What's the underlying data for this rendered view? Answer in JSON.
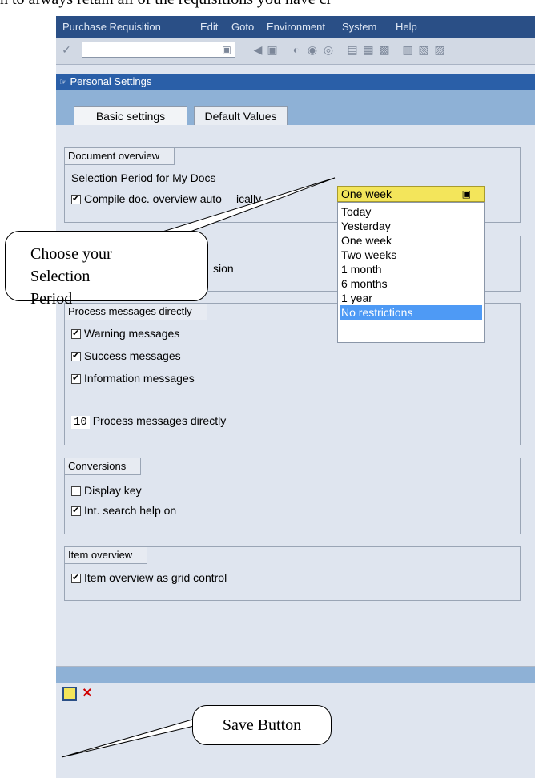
{
  "document_heading": "n to always retain all of the requisitions you have cr",
  "menubar": {
    "items": [
      "Purchase Requisition",
      "Edit",
      "Goto",
      "Environment",
      "System",
      "Help"
    ]
  },
  "title": "Personal Settings",
  "tabs": [
    "Basic settings",
    "Default Values"
  ],
  "groups": {
    "document_overview": {
      "title": "Document overview",
      "selection_label": "Selection Period for My Docs",
      "compile_label": "Compile doc. overview automatically",
      "compile_display": "Compile doc. overview auto",
      "compile_tail": "ically",
      "compile_checked": true
    },
    "hidden_group": {
      "label_tail": "sion"
    },
    "process_messages": {
      "title": "Process messages directly",
      "warning": "Warning messages",
      "success": "Success messages",
      "information": "Information messages",
      "counter_value": "10",
      "counter_label": "Process messages directly"
    },
    "conversions": {
      "title": "Conversions",
      "display_key": "Display key",
      "display_key_checked": false,
      "int_search": "Int. search help on",
      "int_search_checked": true
    },
    "item_overview": {
      "title": "Item overview",
      "grid_control": "Item overview as grid control",
      "grid_control_checked": true
    }
  },
  "dropdown": {
    "selected": "One week",
    "options": [
      "Today",
      "Yesterday",
      "One week",
      "Two weeks",
      "1 month",
      "6 months",
      "1 year",
      "No restrictions"
    ],
    "highlighted_option": "No restrictions"
  },
  "callouts": {
    "selection": "Choose your Selection Period",
    "save": "Save Button"
  },
  "bottom_toolbar": {
    "save_icon": "save-icon",
    "cancel_icon": "cancel-icon"
  },
  "colors": {
    "menubar": "#2a4f86",
    "titlebar": "#2a5fa8",
    "tabstrip": "#8eb1d6",
    "dropdown_highlight": "#f3e55b",
    "selected_option": "#4e9af5"
  }
}
